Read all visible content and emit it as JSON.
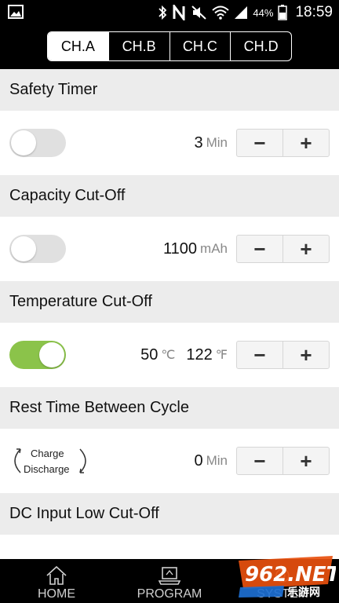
{
  "status_bar": {
    "battery_percent": "44%",
    "time": "18:59",
    "icons": [
      "gallery-icon",
      "bluetooth-icon",
      "nfc-icon",
      "mute-icon",
      "wifi-icon",
      "signal-icon",
      "battery-icon"
    ]
  },
  "channel_tabs": [
    {
      "label": "CH.A",
      "active": true
    },
    {
      "label": "CH.B",
      "active": false
    },
    {
      "label": "CH.C",
      "active": false
    },
    {
      "label": "CH.D",
      "active": false
    }
  ],
  "sections": {
    "safety_timer": {
      "title": "Safety Timer",
      "enabled": false,
      "value": "3",
      "unit": "Min"
    },
    "capacity_cutoff": {
      "title": "Capacity Cut-Off",
      "enabled": false,
      "value": "1100",
      "unit": "mAh"
    },
    "temperature_cutoff": {
      "title": "Temperature Cut-Off",
      "enabled": true,
      "value_c": "50",
      "unit_c": "℃",
      "value_f": "122",
      "unit_f": "℉"
    },
    "rest_time": {
      "title": "Rest Time Between Cycle",
      "cycle_top": "Charge",
      "cycle_bottom": "Discharge",
      "value": "0",
      "unit": "Min"
    },
    "dc_input": {
      "title": "DC Input Low Cut-Off"
    }
  },
  "stepper": {
    "minus": "−",
    "plus": "+"
  },
  "bottom_nav": [
    {
      "label": "HOME",
      "icon": "home-icon"
    },
    {
      "label": "PROGRAM",
      "icon": "laptop-icon"
    },
    {
      "label": "SYSTEM",
      "icon": "system-icon"
    }
  ],
  "watermark": {
    "text": "962.NET",
    "subtext": "乐游网"
  },
  "colors": {
    "toggle_on": "#8bc34a",
    "toggle_off": "#e0e0e0",
    "section_bg": "#ececec"
  }
}
